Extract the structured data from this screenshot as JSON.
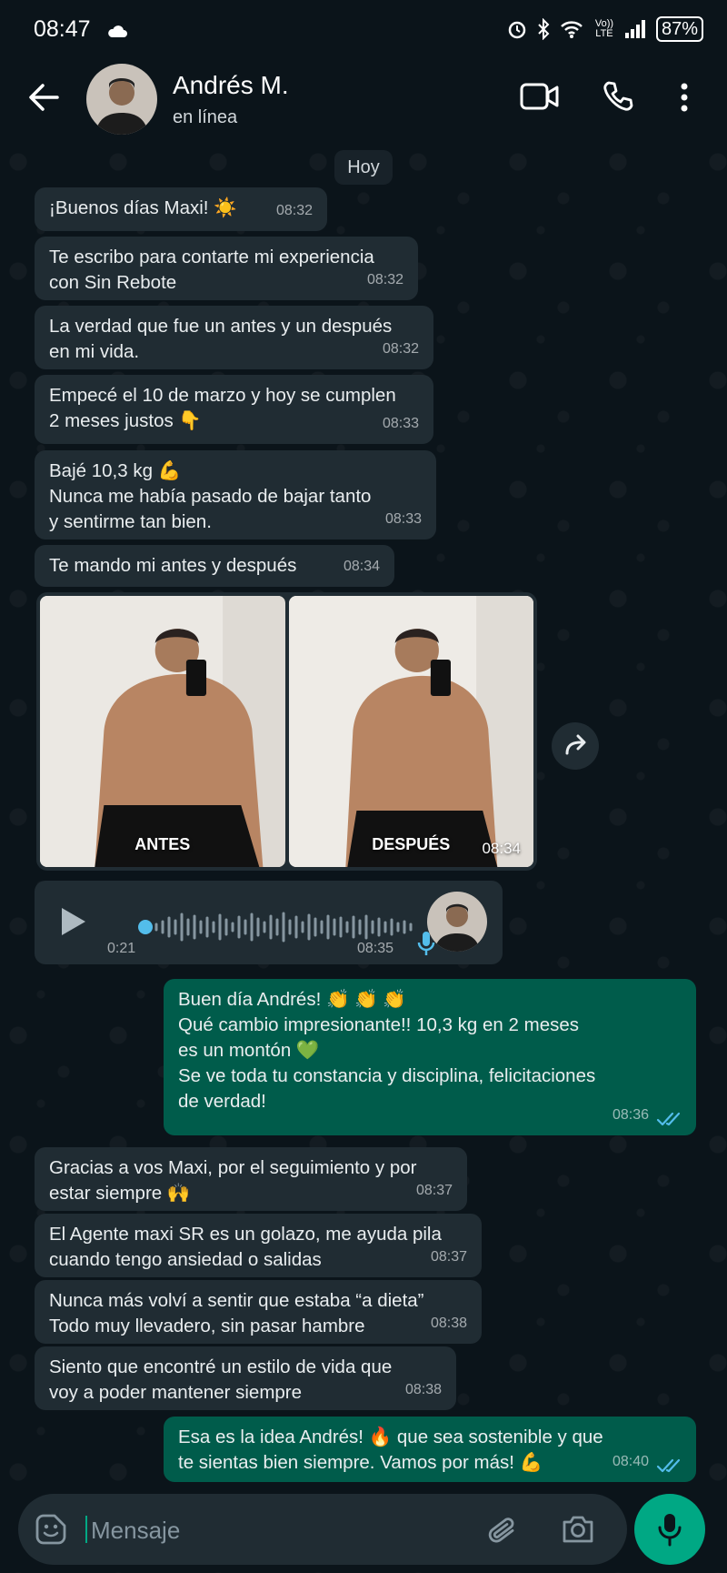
{
  "status_bar": {
    "time": "08:47",
    "battery": "87%",
    "network": "Vo)) LTE"
  },
  "header": {
    "contact_name": "Andrés M.",
    "contact_status": "en línea"
  },
  "chat": {
    "day_label": "Hoy",
    "messages": [
      {
        "text": "¡Buenos días Maxi! ☀️",
        "time": "08:32"
      },
      {
        "text": "Te escribo para contarte mi experiencia\ncon Sin Rebote",
        "time": "08:32"
      },
      {
        "text": "La verdad que fue un antes y un después\nen mi vida.",
        "time": "08:32"
      },
      {
        "text": "Empecé el 10 de marzo y hoy se cumplen\n2 meses justos 👇",
        "time": "08:33"
      },
      {
        "text": "Bajé 10,3 kg 💪\nNunca me había pasado de bajar tanto\ny sentirme tan bien.",
        "time": "08:33"
      },
      {
        "text": "Te mando mi antes y después",
        "time": "08:34"
      },
      {
        "text": "Buen día Andrés! 👏 👏 👏\nQué cambio impresionante!! 10,3 kg en 2 meses\nes un montón 💚\nSe ve toda tu constancia y disciplina, felicitaciones\nde verdad!",
        "time": "08:36"
      },
      {
        "text": "Gracias a vos Maxi, por el seguimiento y por\nestar siempre 🙌",
        "time": "08:37"
      },
      {
        "text": "El Agente maxi SR es un golazo, me ayuda pila\ncuando tengo ansiedad o salidas",
        "time": "08:37"
      },
      {
        "text": "Nunca más volví a sentir que estaba “a dieta”\nTodo muy llevadero, sin pasar hambre",
        "time": "08:38"
      },
      {
        "text": "Siento que encontré un estilo de vida que\nvoy a poder mantener siempre",
        "time": "08:38"
      },
      {
        "text": "Esa es la idea Andrés! 🔥 que sea sostenible y que\nte sientas bien siempre. Vamos por más! 💪",
        "time": "08:40"
      }
    ],
    "photos": {
      "before_label": "ANTES",
      "after_label": "DESPUÉS",
      "time": "08:34"
    },
    "audio": {
      "duration": "0:21",
      "time": "08:35"
    }
  },
  "input": {
    "placeholder": "Mensaje"
  }
}
